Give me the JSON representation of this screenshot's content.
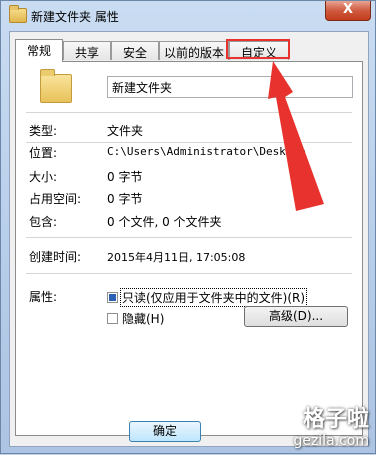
{
  "window": {
    "title": "新建文件夹 属性",
    "close_label": "X"
  },
  "tabs": [
    {
      "label": "常规",
      "active": true
    },
    {
      "label": "共享",
      "active": false
    },
    {
      "label": "安全",
      "active": false
    },
    {
      "label": "以前的版本",
      "active": false
    },
    {
      "label": "自定义",
      "active": false
    }
  ],
  "general": {
    "name_value": "新建文件夹",
    "type_label": "类型:",
    "type_value": "文件夹",
    "location_label": "位置:",
    "location_value": "C:\\Users\\Administrator\\Desktop",
    "size_label": "大小:",
    "size_value": "0 字节",
    "disk_label": "占用空间:",
    "disk_value": "0 字节",
    "contains_label": "包含:",
    "contains_value": "0 个文件, 0 个文件夹",
    "created_label": "创建时间:",
    "created_value": "2015年4月11日, 17:05:08",
    "attributes_label": "属性:",
    "readonly_label": "只读(仅应用于文件夹中的文件)(R)",
    "readonly_checked": true,
    "hidden_label": "隐藏(H)",
    "hidden_checked": false,
    "advanced_button": "高级(D)..."
  },
  "footer": {
    "ok_button": "确定"
  },
  "watermark": {
    "brand": "格子啦",
    "domain": "gezila.com"
  },
  "colors": {
    "annotation": "#e8322d",
    "accent": "#2a5fb4"
  }
}
